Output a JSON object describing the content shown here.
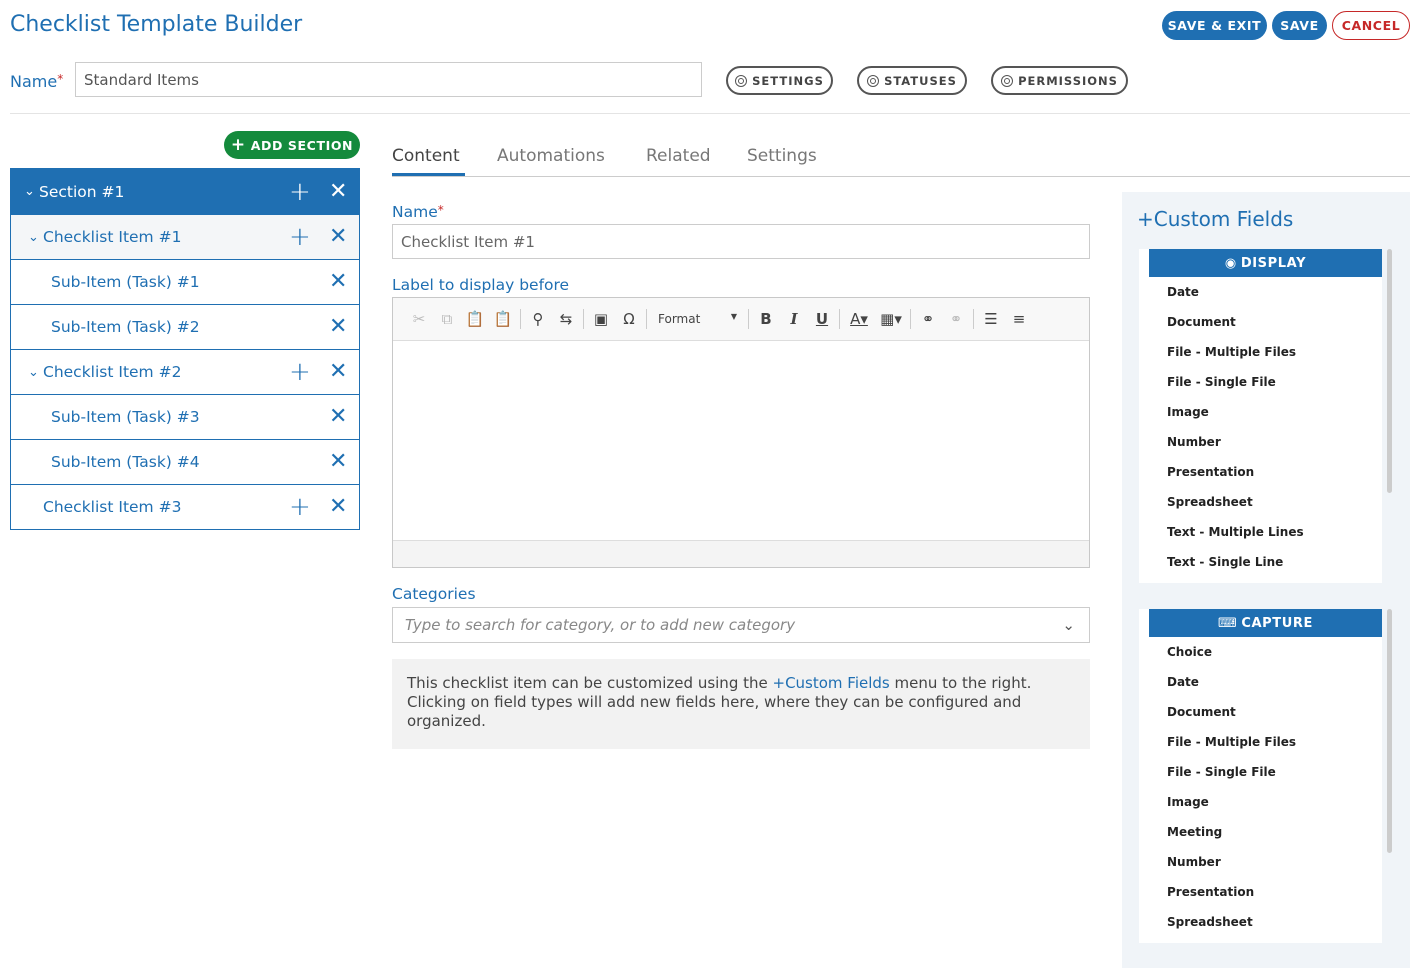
{
  "header": {
    "title": "Checklist Template Builder",
    "save_exit": "SAVE & EXIT",
    "save": "SAVE",
    "cancel": "CANCEL"
  },
  "template": {
    "name_label": "Name",
    "required_mark": "*",
    "name_value": "Standard Items",
    "buttons": [
      "SETTINGS",
      "STATUSES",
      "PERMISSIONS"
    ]
  },
  "tree": {
    "add_section": "ADD SECTION",
    "section_label": "Section #1",
    "items": [
      {
        "label": "Checklist Item #1",
        "type": "item",
        "expanded": true
      },
      {
        "label": "Sub-Item (Task) #1",
        "type": "sub"
      },
      {
        "label": "Sub-Item (Task) #2",
        "type": "sub"
      },
      {
        "label": "Checklist Item #2",
        "type": "item",
        "expanded": true
      },
      {
        "label": "Sub-Item (Task) #3",
        "type": "sub"
      },
      {
        "label": "Sub-Item (Task) #4",
        "type": "sub"
      },
      {
        "label": "Checklist Item #3",
        "type": "item",
        "expanded": false
      }
    ]
  },
  "tabs": [
    "Content",
    "Automations",
    "Related",
    "Settings"
  ],
  "content": {
    "name_label": "Name",
    "name_value": "Checklist Item #1",
    "label_before": "Label to display before",
    "format_label": "Format",
    "categories_label": "Categories",
    "categories_placeholder": "Type to search for category, or to add new category",
    "note_prefix": "This checklist item can be customized using the ",
    "note_link": "Custom Fields",
    "note_suffix": " menu to the right. Clicking on field types will add new fields here, where they can be configured and organized."
  },
  "custom_fields": {
    "title": "Custom Fields",
    "display_header": "DISPLAY",
    "display_items": [
      "Date",
      "Document",
      "File - Multiple Files",
      "File - Single File",
      "Image",
      "Number",
      "Presentation",
      "Spreadsheet",
      "Text - Multiple Lines",
      "Text - Single Line"
    ],
    "capture_header": "CAPTURE",
    "capture_items": [
      "Choice",
      "Date",
      "Document",
      "File - Multiple Files",
      "File - Single File",
      "Image",
      "Meeting",
      "Number",
      "Presentation",
      "Spreadsheet"
    ]
  },
  "colors": {
    "primary": "#1f6fb2",
    "success": "#148a3c",
    "danger": "#c62828"
  }
}
